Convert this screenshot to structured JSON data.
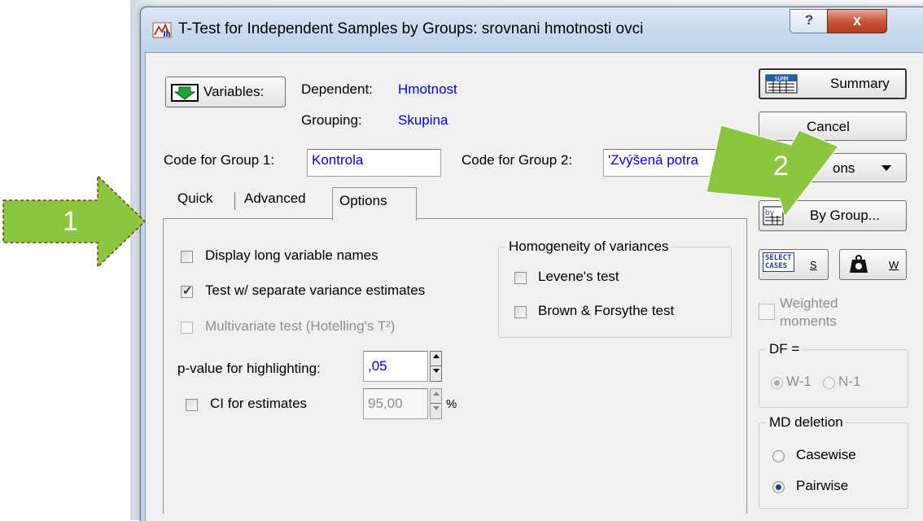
{
  "window": {
    "title": "T-Test for Independent Samples by Groups: srovnani hmotnosti ovci",
    "help_label": "?",
    "close_label": "x"
  },
  "variables": {
    "button_label": "Variables:",
    "dependent_label": "Dependent:",
    "dependent_value": "Hmotnost",
    "grouping_label": "Grouping:",
    "grouping_value": "Skupina"
  },
  "codes": {
    "group1_label": "Code for Group 1:",
    "group1_value": "Kontrola",
    "group2_label": "Code for Group 2:",
    "group2_value": "'Zvýšená potra"
  },
  "tabs": [
    {
      "label": "Quick"
    },
    {
      "label": "Advanced"
    },
    {
      "label": "Options"
    }
  ],
  "options": {
    "display_long_names": "Display long variable names",
    "separate_variance": "Test w/ separate variance estimates",
    "multivariate": "Multivariate test (Hotelling's T²)",
    "pvalue_label": "p-value for highlighting:",
    "pvalue_value": ",05",
    "ci_label": "CI for estimates",
    "ci_value": "95,00",
    "ci_unit": "%",
    "homogeneity_title": "Homogeneity of variances",
    "levene": "Levene's test",
    "brown_forsythe": "Brown & Forsythe test"
  },
  "side": {
    "summary": "Summary",
    "summary_icon_text": "SUMM",
    "cancel": "Cancel",
    "options": "ons",
    "by_group": "By Group...",
    "select_cases_line1": "SELECT",
    "select_cases_line2": "CASES",
    "select_cases_key": "S",
    "weight_key": "W",
    "weighted_moments_line1": "Weighted",
    "weighted_moments_line2": "moments",
    "df_title": "DF =",
    "df_w1": "W-1",
    "df_n1": "N-1",
    "md_title": "MD deletion",
    "casewise": "Casewise",
    "pairwise": "Pairwise"
  },
  "annotations": {
    "arrow1_label": "1",
    "arrow2_label": "2",
    "color": "#8cc63f"
  }
}
